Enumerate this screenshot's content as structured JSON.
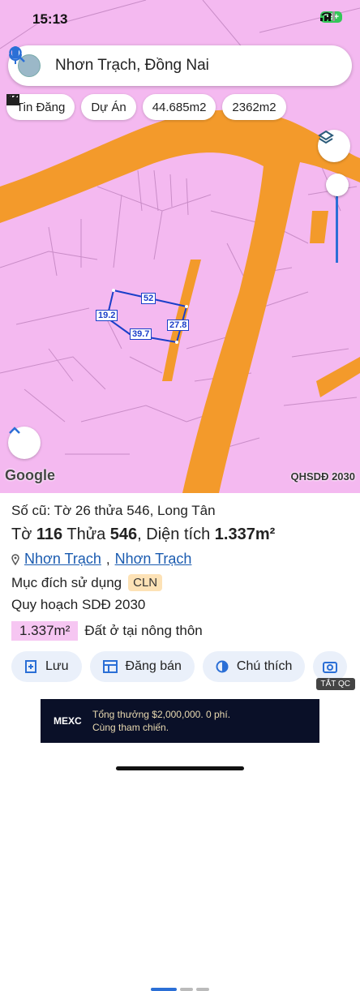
{
  "status": {
    "time": "15:13",
    "battery": "68+"
  },
  "search": {
    "text": "Nhơn Trạch, Đồng Nai"
  },
  "chips": [
    {
      "icon": "newspaper-icon",
      "label": "Tin Đăng"
    },
    {
      "icon": "building-icon",
      "label": "Dự Án"
    },
    {
      "icon": "area-icon",
      "label": "44.685m2"
    },
    {
      "icon": "area-icon",
      "label": "2362m2"
    }
  ],
  "map": {
    "dims": {
      "top": "52",
      "left": "19.2",
      "bottom": "39.7",
      "right": "27.8"
    },
    "google": "Google",
    "layer_label": "QHSDĐ 2030"
  },
  "sheet": {
    "old": "Số cũ: Tờ 26 thửa 546, Long Tân",
    "main": {
      "sheet_label": "Tờ",
      "sheet_no": "116",
      "parcel_label": "Thửa",
      "parcel_no": "546",
      "area_label": ", Diện tích",
      "area": "1.337m²"
    },
    "location": {
      "district": "Nhơn Trạch",
      "sep": ",",
      "ward": "Nhơn Trạch"
    },
    "purpose_label": "Mục đích sử dụng",
    "purpose_code": "CLN",
    "plan": "Quy hoạch SDĐ 2030",
    "plan_area": "1.337m²",
    "plan_desc": "Đất ở tại nông thôn",
    "actions": [
      {
        "icon": "add-note-icon",
        "label": "Lưu"
      },
      {
        "icon": "calculator-icon",
        "label": "Đăng bán"
      },
      {
        "icon": "contrast-icon",
        "label": "Chú thích"
      }
    ],
    "ad_tag": "TẮT QC",
    "ad": {
      "brand": "MEXC",
      "line1": "Tổng thưởng $2,000,000. 0 phí.",
      "line2": "Cùng tham chiến."
    }
  },
  "colors": {
    "map_pink": "#f4b9f0",
    "road_orange": "#f39a2b",
    "accent": "#2b6fd6"
  }
}
